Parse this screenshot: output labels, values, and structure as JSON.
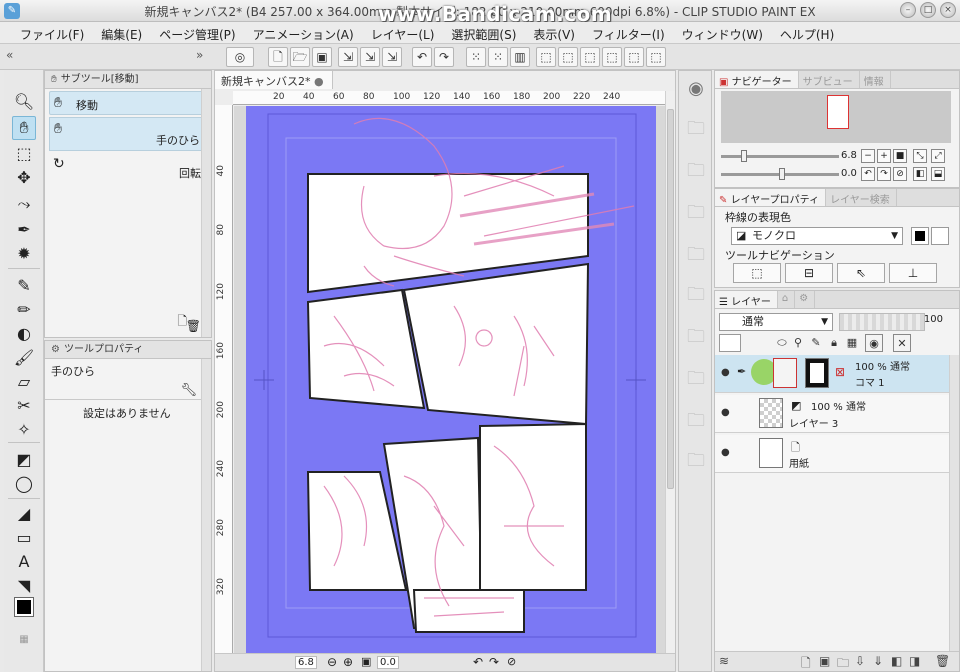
{
  "window": {
    "title": "新規キャンバス2* (B4 257.00 x 364.00mm 製本サイズ: 182.00 x 210.00mm 600dpi 6.8%) - CLIP STUDIO PAINT EX",
    "watermark": "www.Bandicam.com"
  },
  "menu": [
    "ファイル(F)",
    "編集(E)",
    "ページ管理(P)",
    "アニメーション(A)",
    "レイヤー(L)",
    "選択範囲(S)",
    "表示(V)",
    "フィルター(I)",
    "ウィンドウ(W)",
    "ヘルプ(H)"
  ],
  "subtool": {
    "header": "サブツール[移動]",
    "group_label": "移動",
    "items": [
      {
        "label": "手のひら",
        "icon": "hand-icon"
      },
      {
        "label": "回転",
        "icon": "rotate-icon"
      }
    ]
  },
  "toolprop": {
    "header": "ツールプロパティ",
    "tool_name": "手のひら",
    "empty_message": "設定はありません"
  },
  "canvas": {
    "tab_label": "新規キャンバス2*",
    "ruler_h": [
      "20",
      "40",
      "60",
      "80",
      "100",
      "120",
      "140",
      "160",
      "180",
      "200",
      "220",
      "240"
    ],
    "ruler_v": [
      "40",
      "80",
      "120",
      "160",
      "200",
      "240",
      "280",
      "320"
    ],
    "zoom": "6.8",
    "angle": "0.0",
    "colors": {
      "blue": "#7777f2",
      "panel": "#ffffff",
      "sketch": "#e07db0"
    }
  },
  "navigator": {
    "tabs": [
      "ナビゲーター",
      "サブビュー",
      "情報"
    ],
    "zoom": "6.8",
    "angle": "0.0"
  },
  "layer_property": {
    "tabs": [
      "レイヤープロパティ",
      "レイヤー検索"
    ],
    "line_color_label": "枠線の表現色",
    "line_color_value": "モノクロ",
    "tool_nav_label": "ツールナビゲーション"
  },
  "layers": {
    "tab": "レイヤー",
    "blend_mode": "通常",
    "opacity": "100",
    "rows": [
      {
        "opacity_blend": "100 % 通常",
        "name": "コマ 1"
      },
      {
        "opacity_blend": "100 % 通常",
        "name": "レイヤー 3"
      },
      {
        "opacity_blend": "",
        "name": "用紙"
      }
    ]
  }
}
